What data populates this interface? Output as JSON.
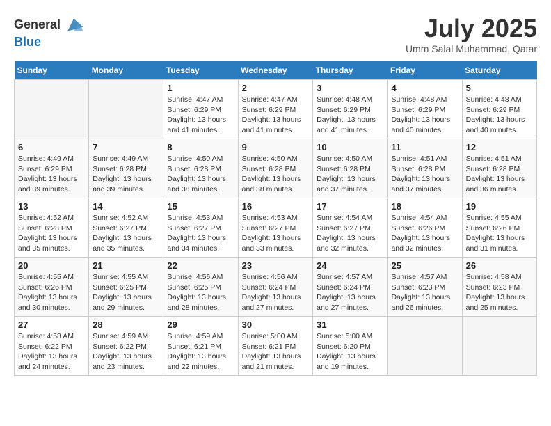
{
  "header": {
    "logo_general": "General",
    "logo_blue": "Blue",
    "month_year": "July 2025",
    "location": "Umm Salal Muhammad, Qatar"
  },
  "days_of_week": [
    "Sunday",
    "Monday",
    "Tuesday",
    "Wednesday",
    "Thursday",
    "Friday",
    "Saturday"
  ],
  "weeks": [
    [
      {
        "day": "",
        "content": ""
      },
      {
        "day": "",
        "content": ""
      },
      {
        "day": "1",
        "content": "Sunrise: 4:47 AM\nSunset: 6:29 PM\nDaylight: 13 hours and 41 minutes."
      },
      {
        "day": "2",
        "content": "Sunrise: 4:47 AM\nSunset: 6:29 PM\nDaylight: 13 hours and 41 minutes."
      },
      {
        "day": "3",
        "content": "Sunrise: 4:48 AM\nSunset: 6:29 PM\nDaylight: 13 hours and 41 minutes."
      },
      {
        "day": "4",
        "content": "Sunrise: 4:48 AM\nSunset: 6:29 PM\nDaylight: 13 hours and 40 minutes."
      },
      {
        "day": "5",
        "content": "Sunrise: 4:48 AM\nSunset: 6:29 PM\nDaylight: 13 hours and 40 minutes."
      }
    ],
    [
      {
        "day": "6",
        "content": "Sunrise: 4:49 AM\nSunset: 6:29 PM\nDaylight: 13 hours and 39 minutes."
      },
      {
        "day": "7",
        "content": "Sunrise: 4:49 AM\nSunset: 6:28 PM\nDaylight: 13 hours and 39 minutes."
      },
      {
        "day": "8",
        "content": "Sunrise: 4:50 AM\nSunset: 6:28 PM\nDaylight: 13 hours and 38 minutes."
      },
      {
        "day": "9",
        "content": "Sunrise: 4:50 AM\nSunset: 6:28 PM\nDaylight: 13 hours and 38 minutes."
      },
      {
        "day": "10",
        "content": "Sunrise: 4:50 AM\nSunset: 6:28 PM\nDaylight: 13 hours and 37 minutes."
      },
      {
        "day": "11",
        "content": "Sunrise: 4:51 AM\nSunset: 6:28 PM\nDaylight: 13 hours and 37 minutes."
      },
      {
        "day": "12",
        "content": "Sunrise: 4:51 AM\nSunset: 6:28 PM\nDaylight: 13 hours and 36 minutes."
      }
    ],
    [
      {
        "day": "13",
        "content": "Sunrise: 4:52 AM\nSunset: 6:28 PM\nDaylight: 13 hours and 35 minutes."
      },
      {
        "day": "14",
        "content": "Sunrise: 4:52 AM\nSunset: 6:27 PM\nDaylight: 13 hours and 35 minutes."
      },
      {
        "day": "15",
        "content": "Sunrise: 4:53 AM\nSunset: 6:27 PM\nDaylight: 13 hours and 34 minutes."
      },
      {
        "day": "16",
        "content": "Sunrise: 4:53 AM\nSunset: 6:27 PM\nDaylight: 13 hours and 33 minutes."
      },
      {
        "day": "17",
        "content": "Sunrise: 4:54 AM\nSunset: 6:27 PM\nDaylight: 13 hours and 32 minutes."
      },
      {
        "day": "18",
        "content": "Sunrise: 4:54 AM\nSunset: 6:26 PM\nDaylight: 13 hours and 32 minutes."
      },
      {
        "day": "19",
        "content": "Sunrise: 4:55 AM\nSunset: 6:26 PM\nDaylight: 13 hours and 31 minutes."
      }
    ],
    [
      {
        "day": "20",
        "content": "Sunrise: 4:55 AM\nSunset: 6:26 PM\nDaylight: 13 hours and 30 minutes."
      },
      {
        "day": "21",
        "content": "Sunrise: 4:55 AM\nSunset: 6:25 PM\nDaylight: 13 hours and 29 minutes."
      },
      {
        "day": "22",
        "content": "Sunrise: 4:56 AM\nSunset: 6:25 PM\nDaylight: 13 hours and 28 minutes."
      },
      {
        "day": "23",
        "content": "Sunrise: 4:56 AM\nSunset: 6:24 PM\nDaylight: 13 hours and 27 minutes."
      },
      {
        "day": "24",
        "content": "Sunrise: 4:57 AM\nSunset: 6:24 PM\nDaylight: 13 hours and 27 minutes."
      },
      {
        "day": "25",
        "content": "Sunrise: 4:57 AM\nSunset: 6:23 PM\nDaylight: 13 hours and 26 minutes."
      },
      {
        "day": "26",
        "content": "Sunrise: 4:58 AM\nSunset: 6:23 PM\nDaylight: 13 hours and 25 minutes."
      }
    ],
    [
      {
        "day": "27",
        "content": "Sunrise: 4:58 AM\nSunset: 6:22 PM\nDaylight: 13 hours and 24 minutes."
      },
      {
        "day": "28",
        "content": "Sunrise: 4:59 AM\nSunset: 6:22 PM\nDaylight: 13 hours and 23 minutes."
      },
      {
        "day": "29",
        "content": "Sunrise: 4:59 AM\nSunset: 6:21 PM\nDaylight: 13 hours and 22 minutes."
      },
      {
        "day": "30",
        "content": "Sunrise: 5:00 AM\nSunset: 6:21 PM\nDaylight: 13 hours and 21 minutes."
      },
      {
        "day": "31",
        "content": "Sunrise: 5:00 AM\nSunset: 6:20 PM\nDaylight: 13 hours and 19 minutes."
      },
      {
        "day": "",
        "content": ""
      },
      {
        "day": "",
        "content": ""
      }
    ]
  ]
}
